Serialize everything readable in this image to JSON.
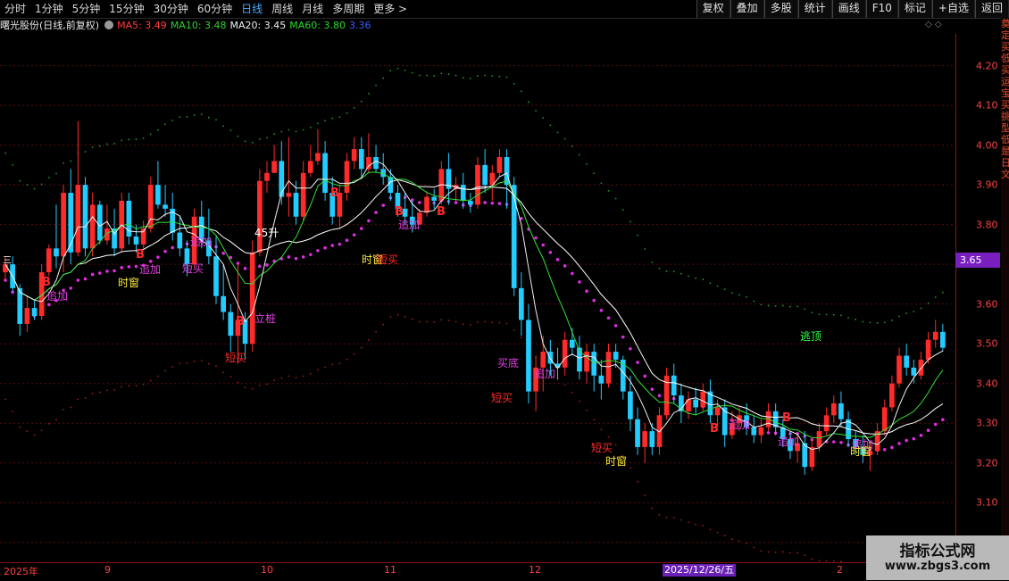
{
  "toolbar": {
    "periods": [
      "分时",
      "1分钟",
      "5分钟",
      "15分钟",
      "30分钟",
      "60分钟",
      "日线",
      "周线",
      "月线",
      "多周期",
      "更多 >"
    ],
    "active_period": "日线",
    "tools": [
      "复权",
      "叠加",
      "多股",
      "统计",
      "画线",
      "F10",
      "标记",
      "+自选",
      "返回"
    ]
  },
  "info": {
    "stock_name": "曙光股份(日线,前复权)",
    "ma5": "MA5: 3.49",
    "ma10": "MA10: 3.48",
    "ma20": "MA20: 3.45",
    "ma60": "MA60: 3.80",
    "extra": "3.36"
  },
  "price_axis": [
    "4.20",
    "4.10",
    "4.00",
    "3.90",
    "3.80",
    "3.70",
    "3.60",
    "3.50",
    "3.40",
    "3.30",
    "3.20",
    "3.10",
    "3.00"
  ],
  "current_price": "3.65",
  "date_axis": [
    "2025年",
    "9",
    "10",
    "11",
    "12",
    "1",
    "2"
  ],
  "date_highlight": "2025/12/26/五",
  "signals": {
    "b1": "B",
    "zj1": "追加",
    "sc1": "时窗",
    "b2": "B",
    "zj2": "追加",
    "dm1": "短买",
    "zj3": "追加",
    "b3": "B",
    "dm2": "短买",
    "lz": "立桩",
    "n45": "45升",
    "b4": "B",
    "b5": "B",
    "zj4": "追加",
    "sc2": "时窗",
    "dm3": "短买",
    "b6": "B",
    "md": "买底",
    "dm4": "短买",
    "zj5": "追加",
    "dm5": "短买",
    "sc3": "时窗",
    "b7": "B",
    "zj6": "追加",
    "ttop": "逃顶",
    "b8": "B",
    "zj7": "追加",
    "zj8": "追加",
    "sc4": "时窗",
    "sc0": "三"
  },
  "side_strip": "奠定买低买运宝买挑型低是日文",
  "watermark": {
    "title": "指标公式网",
    "url": "www.zbgs3.com"
  },
  "colors": {
    "up": "#ff2a2a",
    "down": "#22ccff",
    "bg": "#000000",
    "grid": "#5a0c0c",
    "accent": "#7a1fbf"
  },
  "chart_data": {
    "type": "candlestick",
    "y_range": [
      2.95,
      4.28
    ],
    "candles": [
      [
        3.68,
        3.72,
        3.66,
        3.7
      ],
      [
        3.7,
        3.72,
        3.63,
        3.64
      ],
      [
        3.64,
        3.65,
        3.52,
        3.55
      ],
      [
        3.55,
        3.62,
        3.53,
        3.59
      ],
      [
        3.59,
        3.61,
        3.56,
        3.57
      ],
      [
        3.57,
        3.7,
        3.56,
        3.68
      ],
      [
        3.68,
        3.75,
        3.67,
        3.74
      ],
      [
        3.74,
        3.85,
        3.69,
        3.72
      ],
      [
        3.72,
        3.9,
        3.68,
        3.88
      ],
      [
        3.88,
        3.94,
        3.7,
        3.73
      ],
      [
        3.73,
        4.06,
        3.72,
        3.9
      ],
      [
        3.9,
        3.92,
        3.72,
        3.74
      ],
      [
        3.74,
        3.88,
        3.72,
        3.85
      ],
      [
        3.85,
        3.86,
        3.75,
        3.76
      ],
      [
        3.76,
        3.85,
        3.75,
        3.79
      ],
      [
        3.79,
        3.84,
        3.72,
        3.74
      ],
      [
        3.74,
        3.88,
        3.73,
        3.86
      ],
      [
        3.86,
        3.88,
        3.75,
        3.77
      ],
      [
        3.77,
        3.8,
        3.73,
        3.75
      ],
      [
        3.75,
        3.81,
        3.74,
        3.79
      ],
      [
        3.79,
        3.92,
        3.78,
        3.9
      ],
      [
        3.9,
        3.96,
        3.84,
        3.85
      ],
      [
        3.85,
        3.9,
        3.82,
        3.84
      ],
      [
        3.84,
        3.88,
        3.76,
        3.78
      ],
      [
        3.78,
        3.82,
        3.72,
        3.74
      ],
      [
        3.74,
        3.76,
        3.67,
        3.7
      ],
      [
        3.7,
        3.84,
        3.69,
        3.82
      ],
      [
        3.82,
        3.86,
        3.74,
        3.76
      ],
      [
        3.76,
        3.84,
        3.7,
        3.72
      ],
      [
        3.72,
        3.77,
        3.6,
        3.62
      ],
      [
        3.62,
        3.7,
        3.56,
        3.58
      ],
      [
        3.58,
        3.6,
        3.48,
        3.52
      ],
      [
        3.52,
        3.7,
        3.45,
        3.56
      ],
      [
        3.56,
        3.58,
        3.46,
        3.5
      ],
      [
        3.5,
        3.76,
        3.48,
        3.73
      ],
      [
        3.73,
        3.94,
        3.72,
        3.91
      ],
      [
        3.91,
        3.96,
        3.88,
        3.93
      ],
      [
        3.93,
        4.0,
        3.95,
        3.96
      ],
      [
        3.96,
        4.01,
        3.85,
        3.87
      ],
      [
        3.87,
        4.02,
        3.82,
        3.88
      ],
      [
        3.88,
        3.91,
        3.8,
        3.82
      ],
      [
        3.82,
        3.96,
        3.81,
        3.93
      ],
      [
        3.93,
        4.0,
        3.92,
        3.96
      ],
      [
        3.96,
        4.04,
        3.95,
        3.98
      ],
      [
        3.98,
        4.01,
        3.86,
        3.88
      ],
      [
        3.88,
        3.92,
        3.8,
        3.82
      ],
      [
        3.82,
        3.9,
        3.79,
        3.88
      ],
      [
        3.88,
        3.98,
        3.86,
        3.96
      ],
      [
        3.96,
        4.02,
        3.94,
        3.99
      ],
      [
        3.99,
        4.02,
        3.92,
        3.94
      ],
      [
        3.94,
        4.03,
        3.93,
        3.97
      ],
      [
        3.97,
        4.0,
        3.93,
        3.94
      ],
      [
        3.94,
        3.98,
        3.9,
        3.92
      ],
      [
        3.92,
        3.94,
        3.86,
        3.88
      ],
      [
        3.88,
        3.9,
        3.82,
        3.84
      ],
      [
        3.84,
        3.88,
        3.8,
        3.82
      ],
      [
        3.82,
        3.86,
        3.78,
        3.8
      ],
      [
        3.8,
        3.84,
        3.8,
        3.83
      ],
      [
        3.83,
        3.88,
        3.82,
        3.87
      ],
      [
        3.87,
        3.89,
        3.84,
        3.86
      ],
      [
        3.86,
        3.96,
        3.85,
        3.94
      ],
      [
        3.94,
        3.98,
        3.85,
        3.89
      ],
      [
        3.89,
        3.92,
        3.86,
        3.9
      ],
      [
        3.9,
        3.93,
        3.84,
        3.86
      ],
      [
        3.86,
        3.88,
        3.83,
        3.85
      ],
      [
        3.85,
        3.97,
        3.84,
        3.95
      ],
      [
        3.95,
        3.99,
        3.88,
        3.9
      ],
      [
        3.9,
        3.95,
        3.86,
        3.93
      ],
      [
        3.93,
        3.99,
        3.92,
        3.97
      ],
      [
        3.97,
        3.99,
        3.84,
        3.9
      ],
      [
        3.9,
        3.92,
        3.62,
        3.64
      ],
      [
        3.64,
        3.68,
        3.52,
        3.56
      ],
      [
        3.56,
        3.6,
        3.35,
        3.38
      ],
      [
        3.38,
        3.47,
        3.33,
        3.44
      ],
      [
        3.44,
        3.52,
        3.38,
        3.48
      ],
      [
        3.48,
        3.51,
        3.42,
        3.45
      ],
      [
        3.45,
        3.49,
        3.41,
        3.44
      ],
      [
        3.44,
        3.53,
        3.42,
        3.51
      ],
      [
        3.51,
        3.54,
        3.47,
        3.49
      ],
      [
        3.49,
        3.52,
        3.41,
        3.43
      ],
      [
        3.43,
        3.5,
        3.4,
        3.48
      ],
      [
        3.48,
        3.5,
        3.38,
        3.42
      ],
      [
        3.42,
        3.46,
        3.36,
        3.4
      ],
      [
        3.4,
        3.5,
        3.39,
        3.48
      ],
      [
        3.48,
        3.5,
        3.44,
        3.46
      ],
      [
        3.46,
        3.47,
        3.36,
        3.38
      ],
      [
        3.38,
        3.42,
        3.28,
        3.31
      ],
      [
        3.31,
        3.34,
        3.22,
        3.24
      ],
      [
        3.24,
        3.3,
        3.2,
        3.28
      ],
      [
        3.28,
        3.3,
        3.22,
        3.24
      ],
      [
        3.24,
        3.34,
        3.22,
        3.32
      ],
      [
        3.32,
        3.44,
        3.31,
        3.42
      ],
      [
        3.42,
        3.45,
        3.35,
        3.37
      ],
      [
        3.37,
        3.4,
        3.3,
        3.33
      ],
      [
        3.33,
        3.38,
        3.31,
        3.36
      ],
      [
        3.36,
        3.39,
        3.32,
        3.34
      ],
      [
        3.34,
        3.4,
        3.33,
        3.38
      ],
      [
        3.38,
        3.41,
        3.3,
        3.32
      ],
      [
        3.32,
        3.36,
        3.29,
        3.34
      ],
      [
        3.34,
        3.36,
        3.24,
        3.27
      ],
      [
        3.27,
        3.33,
        3.26,
        3.3
      ],
      [
        3.3,
        3.34,
        3.28,
        3.32
      ],
      [
        3.32,
        3.35,
        3.27,
        3.29
      ],
      [
        3.29,
        3.32,
        3.25,
        3.27
      ],
      [
        3.27,
        3.31,
        3.25,
        3.29
      ],
      [
        3.29,
        3.35,
        3.28,
        3.33
      ],
      [
        3.33,
        3.35,
        3.27,
        3.29
      ],
      [
        3.29,
        3.31,
        3.24,
        3.26
      ],
      [
        3.26,
        3.28,
        3.21,
        3.23
      ],
      [
        3.23,
        3.27,
        3.2,
        3.25
      ],
      [
        3.25,
        3.28,
        3.17,
        3.19
      ],
      [
        3.19,
        3.26,
        3.18,
        3.24
      ],
      [
        3.24,
        3.3,
        3.23,
        3.28
      ],
      [
        3.28,
        3.34,
        3.27,
        3.32
      ],
      [
        3.32,
        3.37,
        3.3,
        3.35
      ],
      [
        3.35,
        3.38,
        3.29,
        3.31
      ],
      [
        3.31,
        3.33,
        3.24,
        3.26
      ],
      [
        3.26,
        3.28,
        3.22,
        3.24
      ],
      [
        3.24,
        3.27,
        3.2,
        3.22
      ],
      [
        3.22,
        3.25,
        3.18,
        3.23
      ],
      [
        3.23,
        3.3,
        3.22,
        3.28
      ],
      [
        3.28,
        3.36,
        3.27,
        3.34
      ],
      [
        3.34,
        3.42,
        3.33,
        3.4
      ],
      [
        3.4,
        3.49,
        3.39,
        3.47
      ],
      [
        3.47,
        3.5,
        3.42,
        3.44
      ],
      [
        3.44,
        3.46,
        3.4,
        3.42
      ],
      [
        3.42,
        3.48,
        3.41,
        3.46
      ],
      [
        3.46,
        3.53,
        3.45,
        3.51
      ],
      [
        3.51,
        3.56,
        3.49,
        3.53
      ],
      [
        3.53,
        3.55,
        3.48,
        3.49
      ]
    ],
    "ma5_line_level": "MA5",
    "upper_band": "green dotted",
    "lower_band": "red dotted",
    "support": "magenta dotted"
  }
}
